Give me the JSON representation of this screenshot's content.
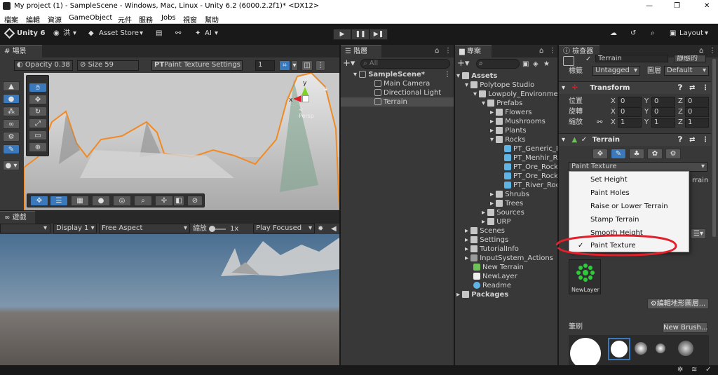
{
  "window": {
    "title": "My project (1) - SampleScene - Windows, Mac, Linux - Unity 6.2 (6000.2.2f1)* <DX12>",
    "min": "—",
    "max": "❐",
    "close": "✕"
  },
  "menu": [
    "檔案",
    "編輯",
    "資源",
    "GameObject",
    "元件",
    "服務",
    "Jobs",
    "視窗",
    "幫助"
  ],
  "toolbar": {
    "unity": "Unity 6",
    "account": "洪",
    "asset_store": "Asset Store",
    "ai": "AI",
    "layout": "Layout"
  },
  "scene": {
    "tab": "場景",
    "opacity": "Opacity 0.38",
    "size": "Size 59",
    "settings_prefix": "PT",
    "settings": "Paint Texture Settings",
    "count": "1",
    "persp": "< Persp",
    "axis_y": "y",
    "axis_x": "x"
  },
  "game": {
    "tab": "遊戲",
    "display": "Display 1",
    "aspect": "Free Aspect",
    "scale_label": "縮放",
    "scale_value": "1x",
    "play_focused": "Play Focused"
  },
  "hierarchy": {
    "tab": "階層",
    "search_placeholder": "All",
    "items": [
      {
        "label": "SampleScene*"
      },
      {
        "label": "Main Camera"
      },
      {
        "label": "Directional Light"
      },
      {
        "label": "Terrain"
      }
    ]
  },
  "project": {
    "tab": "專案",
    "items": [
      {
        "label": "Assets"
      },
      {
        "label": "Polytope Studio"
      },
      {
        "label": "Lowpoly_Environments"
      },
      {
        "label": "Prefabs"
      },
      {
        "label": "Flowers"
      },
      {
        "label": "Mushrooms"
      },
      {
        "label": "Plants"
      },
      {
        "label": "Rocks"
      },
      {
        "label": "PT_Generic_Rock"
      },
      {
        "label": "PT_Menhir_Rock"
      },
      {
        "label": "PT_Ore_Rock_"
      },
      {
        "label": "PT_Ore_Rock_"
      },
      {
        "label": "PT_River_Rock"
      },
      {
        "label": "Shrubs"
      },
      {
        "label": "Trees"
      },
      {
        "label": "Sources"
      },
      {
        "label": "URP"
      },
      {
        "label": "Scenes"
      },
      {
        "label": "Settings"
      },
      {
        "label": "TutorialInfo"
      },
      {
        "label": "InputSystem_Actions"
      },
      {
        "label": "New Terrain"
      },
      {
        "label": "NewLayer"
      },
      {
        "label": "Readme"
      },
      {
        "label": "Packages"
      }
    ]
  },
  "inspector": {
    "tab": "檢查器",
    "object_name": "Terrain",
    "static": "靜態的",
    "tag_label": "標籤",
    "tag": "Untagged",
    "layer_label": "圖層",
    "layer": "Default",
    "transform": {
      "title": "Transform",
      "position": "位置",
      "rotation": "旋轉",
      "scale": "縮放",
      "x": "X",
      "y": "Y",
      "z": "Z",
      "pos": [
        "0",
        "0",
        "0"
      ],
      "rot": [
        "0",
        "0",
        "0"
      ],
      "scl": [
        "1",
        "1",
        "1"
      ]
    },
    "terrain": {
      "title": "Terrain",
      "tool": "Paint Texture",
      "hint_right": "rrain",
      "layer_name": "NewLayer",
      "edit_layers": "編輯地形圖層...",
      "brushes": "筆刷",
      "new_brush": "New Brush..."
    }
  },
  "dropdown": {
    "items": [
      {
        "label": "Set Height"
      },
      {
        "label": "Paint Holes"
      },
      {
        "label": "Raise or Lower Terrain"
      },
      {
        "label": "Stamp Terrain"
      },
      {
        "label": "Smooth Height"
      },
      {
        "label": "Paint Texture",
        "check": "✓"
      }
    ]
  },
  "colors": {
    "accent_blue": "#3a79bb",
    "annotation_red": "#e0202a",
    "selection_outline": "#f08a24",
    "brush_green": "#2ecc3a"
  }
}
